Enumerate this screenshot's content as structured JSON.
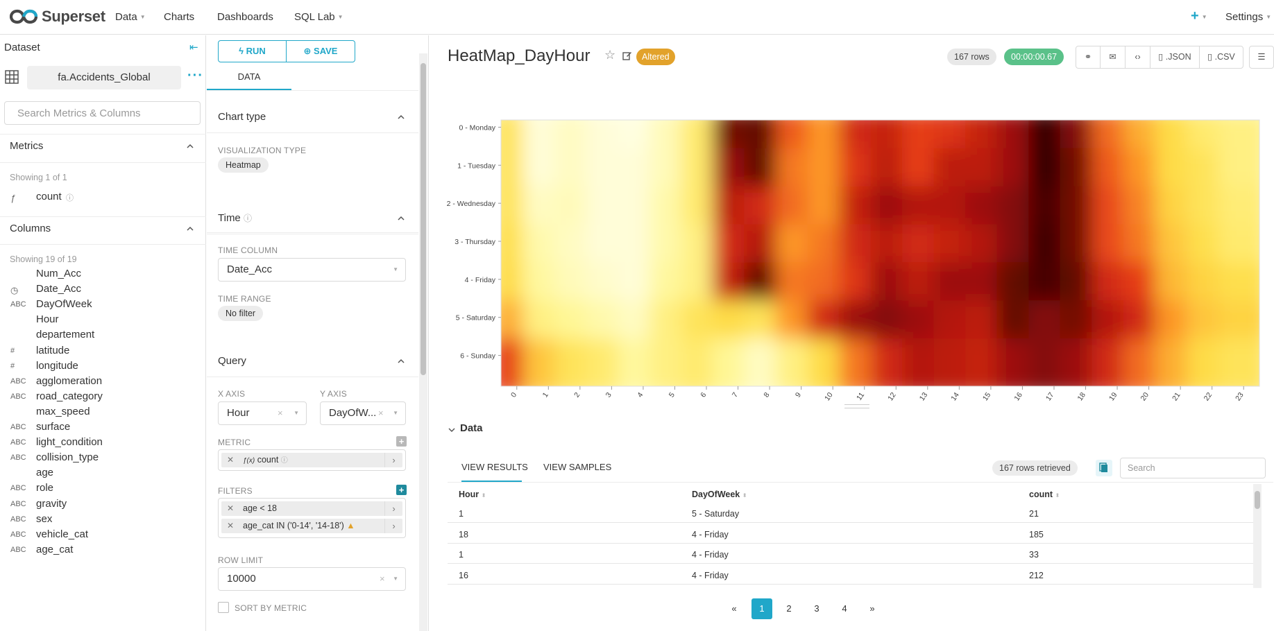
{
  "nav": {
    "brand": "Superset",
    "items": [
      {
        "label": "Data",
        "dropdown": true
      },
      {
        "label": "Charts",
        "dropdown": false
      },
      {
        "label": "Dashboards",
        "dropdown": false
      },
      {
        "label": "SQL Lab",
        "dropdown": true
      }
    ],
    "plus": "+",
    "settings": "Settings"
  },
  "dataset": {
    "title": "Dataset",
    "name": "fa.Accidents_Global",
    "search_placeholder": "Search Metrics & Columns",
    "metrics": {
      "header": "Metrics",
      "showing": "Showing 1 of 1",
      "items": [
        {
          "type": "ƒ",
          "name": "count"
        }
      ]
    },
    "columns": {
      "header": "Columns",
      "showing": "Showing 19 of 19",
      "items": [
        {
          "type": "",
          "name": "Num_Acc"
        },
        {
          "type": "clock",
          "name": "Date_Acc"
        },
        {
          "type": "ABC",
          "name": "DayOfWeek"
        },
        {
          "type": "",
          "name": "Hour"
        },
        {
          "type": "",
          "name": "departement"
        },
        {
          "type": "#",
          "name": "latitude"
        },
        {
          "type": "#",
          "name": "longitude"
        },
        {
          "type": "ABC",
          "name": "agglomeration"
        },
        {
          "type": "ABC",
          "name": "road_category"
        },
        {
          "type": "",
          "name": "max_speed"
        },
        {
          "type": "ABC",
          "name": "surface"
        },
        {
          "type": "ABC",
          "name": "light_condition"
        },
        {
          "type": "ABC",
          "name": "collision_type"
        },
        {
          "type": "",
          "name": "age"
        },
        {
          "type": "ABC",
          "name": "role"
        },
        {
          "type": "ABC",
          "name": "gravity"
        },
        {
          "type": "ABC",
          "name": "sex"
        },
        {
          "type": "ABC",
          "name": "vehicle_cat"
        },
        {
          "type": "ABC",
          "name": "age_cat"
        }
      ]
    }
  },
  "controls": {
    "run_label": "RUN",
    "save_label": "SAVE",
    "tab_data": "DATA",
    "chart_type": {
      "header": "Chart type",
      "viz_label": "VISUALIZATION TYPE",
      "viz_value": "Heatmap"
    },
    "time": {
      "header": "Time",
      "time_column_label": "TIME COLUMN",
      "time_column_value": "Date_Acc",
      "time_range_label": "TIME RANGE",
      "time_range_value": "No filter"
    },
    "query": {
      "header": "Query",
      "x_axis_label": "X AXIS",
      "x_axis_value": "Hour",
      "y_axis_label": "Y AXIS",
      "y_axis_value": "DayOfW...",
      "metric_label": "METRIC",
      "metric_value": "count",
      "metric_prefix": "ƒ(x)",
      "filters_label": "FILTERS",
      "filters": [
        "age < 18",
        "age_cat IN ('0-14', '14-18')"
      ],
      "row_limit_label": "ROW LIMIT",
      "row_limit_value": "10000",
      "sort_by_metric_label": "SORT BY METRIC"
    }
  },
  "chart": {
    "title": "HeatMap_DayHour",
    "altered": "Altered",
    "rows": "167 rows",
    "time": "00:00:00.67",
    "json_label": ".JSON",
    "csv_label": ".CSV"
  },
  "chart_data": {
    "type": "heatmap",
    "x": [
      "0",
      "1",
      "2",
      "3",
      "4",
      "5",
      "6",
      "7",
      "8",
      "9",
      "10",
      "11",
      "12",
      "13",
      "14",
      "15",
      "16",
      "17",
      "18",
      "19",
      "20",
      "21",
      "22",
      "23"
    ],
    "y": [
      "0 - Monday",
      "1 - Tuesday",
      "2 - Wednesday",
      "3 - Thursday",
      "4 - Friday",
      "5 - Saturday",
      "6 - Sunday"
    ],
    "values": [
      [
        0.35,
        0.05,
        0.1,
        0.05,
        0.03,
        0.12,
        0.3,
        0.9,
        0.92,
        0.65,
        0.55,
        0.75,
        0.78,
        0.7,
        0.72,
        0.78,
        0.85,
        0.97,
        0.88,
        0.62,
        0.5,
        0.4,
        0.3,
        0.25
      ],
      [
        0.35,
        0.05,
        0.1,
        0.05,
        0.05,
        0.12,
        0.3,
        0.85,
        0.92,
        0.6,
        0.55,
        0.72,
        0.8,
        0.7,
        0.8,
        0.8,
        0.85,
        0.97,
        0.9,
        0.65,
        0.55,
        0.4,
        0.35,
        0.25
      ],
      [
        0.35,
        0.1,
        0.12,
        0.05,
        0.05,
        0.15,
        0.3,
        0.8,
        0.75,
        0.62,
        0.55,
        0.78,
        0.85,
        0.82,
        0.82,
        0.85,
        0.88,
        0.95,
        0.9,
        0.68,
        0.58,
        0.42,
        0.35,
        0.28
      ],
      [
        0.38,
        0.15,
        0.1,
        0.05,
        0.05,
        0.15,
        0.25,
        0.75,
        0.82,
        0.55,
        0.6,
        0.75,
        0.8,
        0.75,
        0.78,
        0.82,
        0.88,
        0.96,
        0.9,
        0.68,
        0.6,
        0.45,
        0.38,
        0.3
      ],
      [
        0.4,
        0.18,
        0.12,
        0.08,
        0.05,
        0.18,
        0.25,
        0.78,
        0.92,
        0.6,
        0.62,
        0.72,
        0.85,
        0.8,
        0.85,
        0.85,
        0.92,
        0.95,
        0.92,
        0.75,
        0.7,
        0.48,
        0.42,
        0.38
      ],
      [
        0.5,
        0.25,
        0.2,
        0.15,
        0.1,
        0.25,
        0.35,
        0.4,
        0.35,
        0.55,
        0.75,
        0.85,
        0.88,
        0.85,
        0.82,
        0.8,
        0.92,
        0.88,
        0.9,
        0.82,
        0.75,
        0.55,
        0.45,
        0.42
      ],
      [
        0.7,
        0.45,
        0.35,
        0.3,
        0.18,
        0.25,
        0.3,
        0.2,
        0.1,
        0.25,
        0.4,
        0.6,
        0.75,
        0.82,
        0.8,
        0.78,
        0.85,
        0.88,
        0.85,
        0.75,
        0.62,
        0.5,
        0.4,
        0.35
      ]
    ]
  },
  "data_pane": {
    "header": "Data",
    "tab_results": "VIEW RESULTS",
    "tab_samples": "VIEW SAMPLES",
    "retrieved": "167 rows retrieved",
    "search_placeholder": "Search",
    "columns": [
      "Hour",
      "DayOfWeek",
      "count"
    ],
    "rows": [
      [
        "1",
        "5 - Saturday",
        "21"
      ],
      [
        "18",
        "4 - Friday",
        "185"
      ],
      [
        "1",
        "4 - Friday",
        "33"
      ],
      [
        "16",
        "4 - Friday",
        "212"
      ]
    ],
    "pages": [
      "«",
      "1",
      "2",
      "3",
      "4",
      "»"
    ],
    "active_page": "1"
  }
}
